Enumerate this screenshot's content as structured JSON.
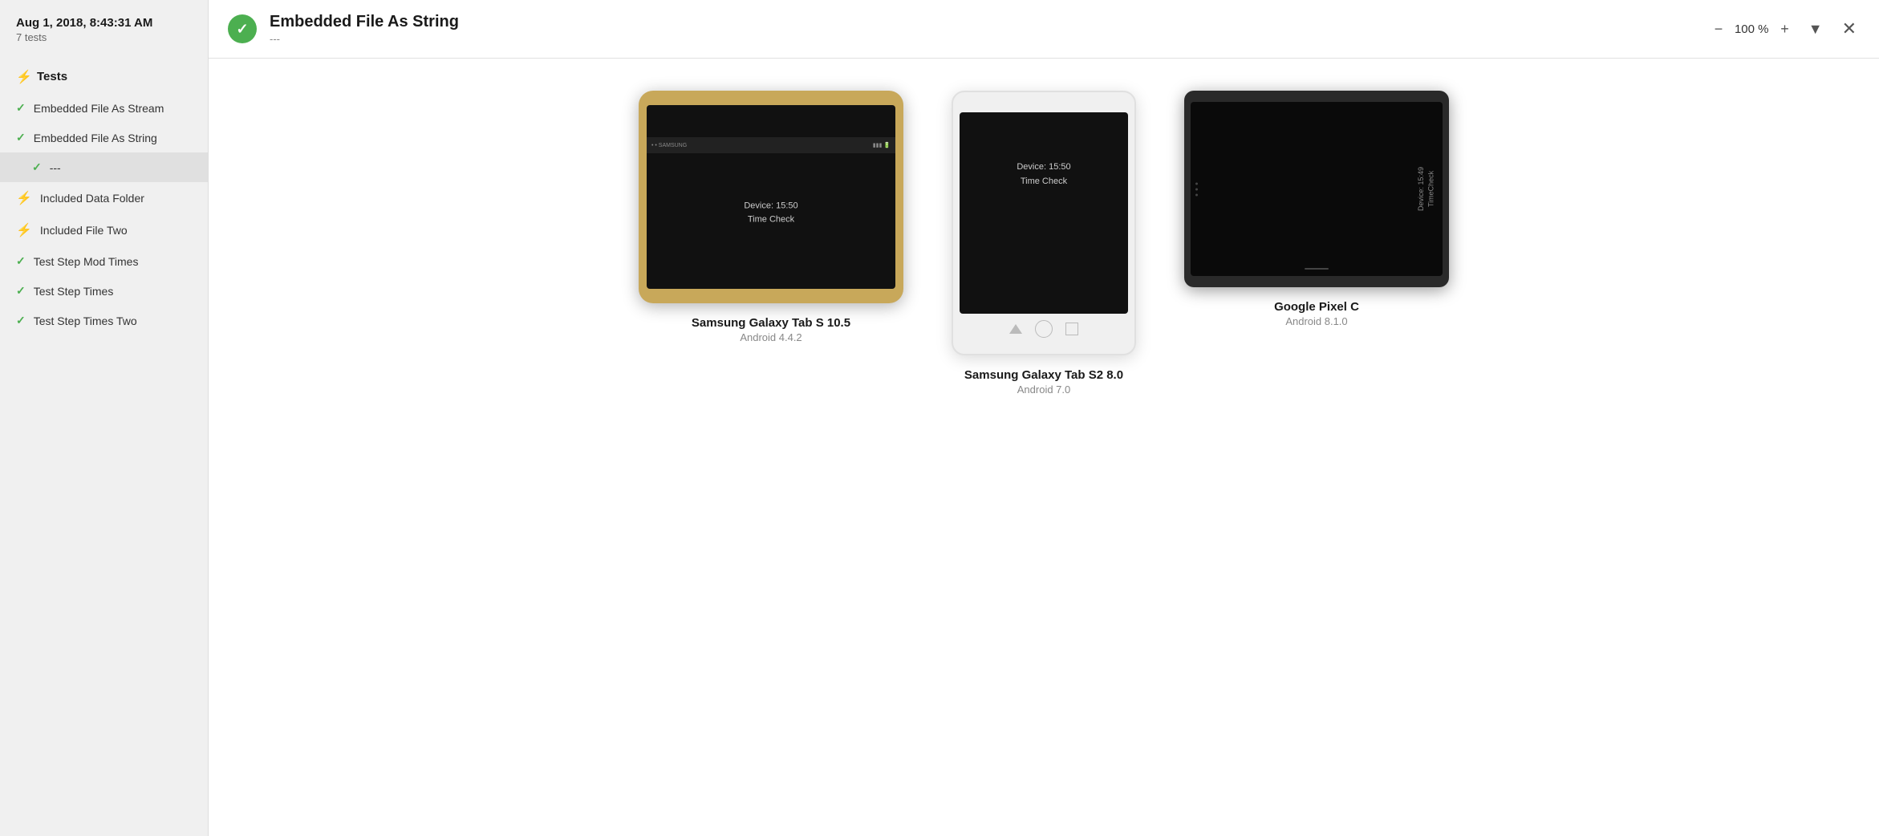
{
  "sidebar": {
    "date": "Aug 1, 2018, 8:43:31 AM",
    "count": "7 tests",
    "section_title": "Tests",
    "items": [
      {
        "id": "embedded-file-stream",
        "label": "Embedded File As Stream",
        "status": "pass",
        "active": false,
        "sub": false
      },
      {
        "id": "embedded-file-string",
        "label": "Embedded File As String",
        "status": "pass",
        "active": false,
        "sub": false
      },
      {
        "id": "dashes",
        "label": "---",
        "status": "pass",
        "active": true,
        "sub": true
      },
      {
        "id": "included-data-folder",
        "label": "Included Data Folder",
        "status": "fail",
        "active": false,
        "sub": false
      },
      {
        "id": "included-file-two",
        "label": "Included File Two",
        "status": "fail",
        "active": false,
        "sub": false
      },
      {
        "id": "test-step-mod-times",
        "label": "Test Step Mod Times",
        "status": "pass",
        "active": false,
        "sub": false
      },
      {
        "id": "test-step-times",
        "label": "Test Step Times",
        "status": "pass",
        "active": false,
        "sub": false
      },
      {
        "id": "test-step-times-two",
        "label": "Test Step Times Two",
        "status": "pass",
        "active": false,
        "sub": false
      }
    ]
  },
  "header": {
    "title": "Embedded File As String",
    "subtitle": "---",
    "zoom": "100 %",
    "check_icon": "✓"
  },
  "devices": [
    {
      "id": "samsung-tab-s-10-5",
      "name": "Samsung Galaxy Tab S 10.5",
      "os": "Android 4.4.2",
      "type": "landscape-gold",
      "screen_line1": "Device: 15:50",
      "screen_line2": "Time Check"
    },
    {
      "id": "samsung-tab-s2-8-0",
      "name": "Samsung Galaxy Tab S2 8.0",
      "os": "Android 7.0",
      "type": "portrait-white",
      "screen_line1": "Device: 15:50",
      "screen_line2": "Time Check"
    },
    {
      "id": "google-pixel-c",
      "name": "Google Pixel C",
      "os": "Android 8.1.0",
      "type": "landscape-dark",
      "screen_line1": "Device: 15:49",
      "screen_line2": "TimeCheck"
    }
  ],
  "controls": {
    "zoom_minus": "−",
    "zoom_value": "100 %",
    "zoom_plus": "+",
    "filter": "▼",
    "close": "✕"
  }
}
